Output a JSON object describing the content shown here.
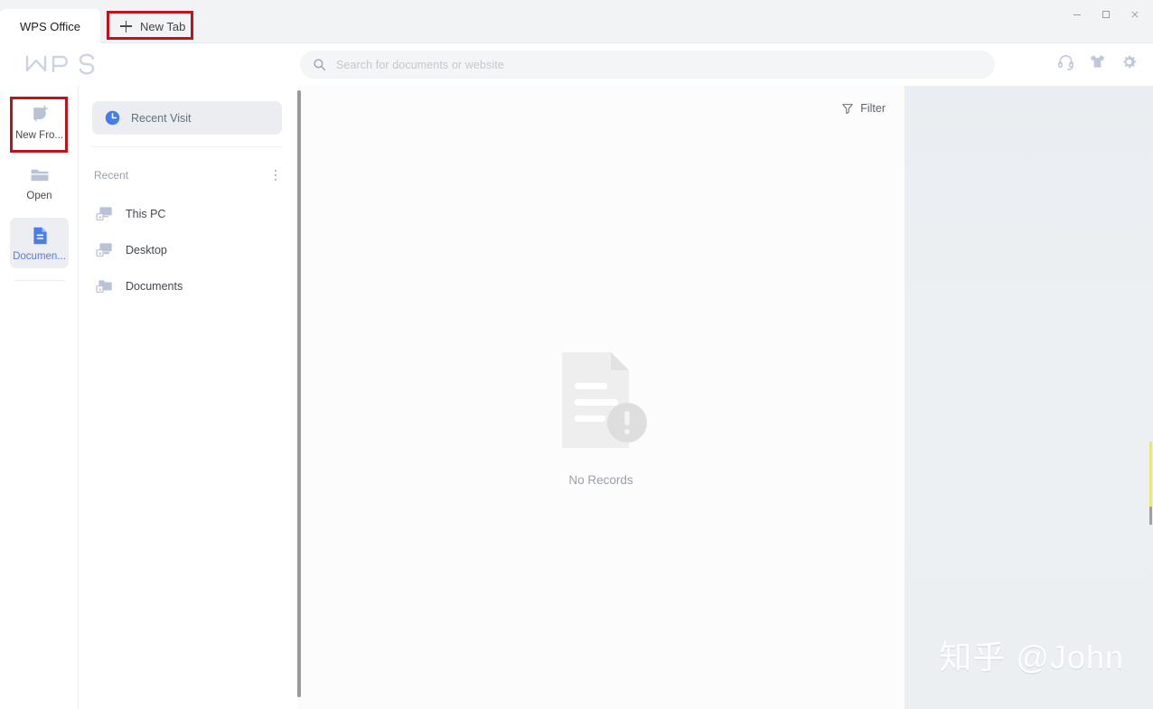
{
  "window": {
    "controls": [
      {
        "name": "minimize",
        "glyph": "—"
      },
      {
        "name": "maximize",
        "glyph": "▢"
      },
      {
        "name": "close",
        "glyph": "✕"
      }
    ]
  },
  "tabs": [
    {
      "label": "WPS Office",
      "active": true
    },
    {
      "label": "New Tab",
      "active": false,
      "icon": "plus-icon",
      "highlighted": true
    }
  ],
  "header": {
    "logo_text": "WPS",
    "search": {
      "placeholder": "Search for documents or website",
      "value": "",
      "icon": "search-icon"
    },
    "actions": [
      {
        "name": "support-headset-icon",
        "title": "Support"
      },
      {
        "name": "skins-tshirt-icon",
        "title": "Skins"
      },
      {
        "name": "settings-gear-icon",
        "title": "Settings"
      }
    ]
  },
  "rail": {
    "items": [
      {
        "label": "New Fro...",
        "icon": "new-from-icon",
        "selected": false,
        "highlighted": true
      },
      {
        "label": "Open",
        "icon": "open-folder-icon",
        "selected": false,
        "highlighted": false
      },
      {
        "label": "Documen...",
        "icon": "documents-file-icon",
        "selected": true,
        "highlighted": false
      }
    ]
  },
  "nav": {
    "primary": {
      "label": "Recent Visit",
      "icon": "clock-icon",
      "selected": true
    },
    "section_title": "Recent",
    "section_menu_icon": "kebab-menu-icon",
    "items": [
      {
        "label": "This PC",
        "icon": "this-pc-icon"
      },
      {
        "label": "Desktop",
        "icon": "desktop-icon"
      },
      {
        "label": "Documents",
        "icon": "folder-icon"
      }
    ]
  },
  "content": {
    "filter": {
      "label": "Filter",
      "icon": "filter-funnel-icon"
    },
    "empty_state": {
      "label": "No Records",
      "icon": "no-records-document-icon"
    }
  },
  "watermark": {
    "text": "知乎 @John"
  },
  "colors": {
    "accent_blue": "#4a7dec",
    "annotation_red": "#c0121b",
    "icon_grey_blue": "#b9c2d6",
    "panel_grey": "#ecedf0"
  }
}
